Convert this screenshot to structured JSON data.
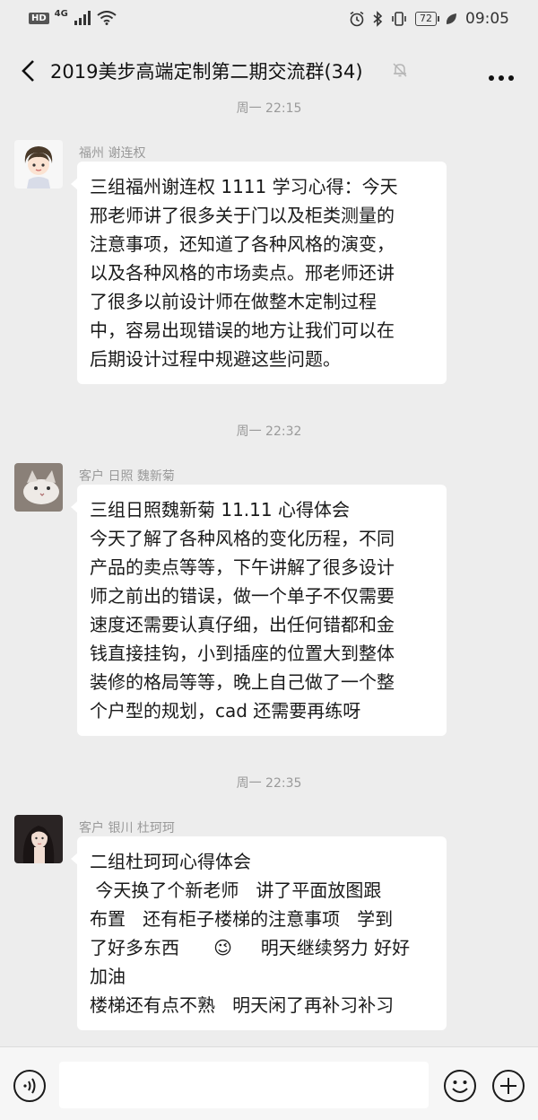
{
  "status_bar": {
    "hd": "HD",
    "network": "4G",
    "battery": "72",
    "time": "09:05"
  },
  "nav": {
    "title": "2019美步高端定制第二期交流群(34)",
    "icons": [
      "back-icon",
      "mute-bell-icon",
      "more-icon"
    ]
  },
  "chat": {
    "messages": [
      {
        "timestamp": "周一 22:15",
        "sender": "福州  谢连权",
        "lines": [
          "三组福州谢连权 1111 学习心得：今天",
          "邢老师讲了很多关于门以及柜类测量的",
          "注意事项，还知道了各种风格的演变，",
          "以及各种风格的市场卖点。邢老师还讲",
          "了很多以前设计师在做整木定制过程",
          "中，容易出现错误的地方让我们可以在",
          "后期设计过程中规避这些问题。"
        ]
      },
      {
        "timestamp": "周一 22:32",
        "sender": "客户 日照 魏新菊",
        "lines": [
          "三组日照魏新菊 11.11 心得体会",
          "今天了解了各种风格的变化历程，不同",
          "产品的卖点等等，下午讲解了很多设计",
          "师之前出的错误，做一个单子不仅需要",
          "速度还需要认真仔细，出任何错都和金",
          "钱直接挂钩，小到插座的位置大到整体",
          "装修的格局等等，晚上自己做了一个整",
          "个户型的规划，cad 还需要再练呀"
        ]
      },
      {
        "timestamp": "周一 22:35",
        "sender": "客户 银川 杜珂珂",
        "lines": [
          "二组杜珂珂心得体会",
          " 今天换了个新老师   讲了平面放图跟",
          "布置   还有柜子楼梯的注意事项   学到",
          "了好多东西      😉     明天继续努力 好好",
          "加油",
          "楼梯还有点不熟   明天闲了再补习补习"
        ]
      }
    ]
  },
  "input_bar": {
    "icons": [
      "voice-icon",
      "emoji-icon",
      "plus-icon"
    ]
  }
}
